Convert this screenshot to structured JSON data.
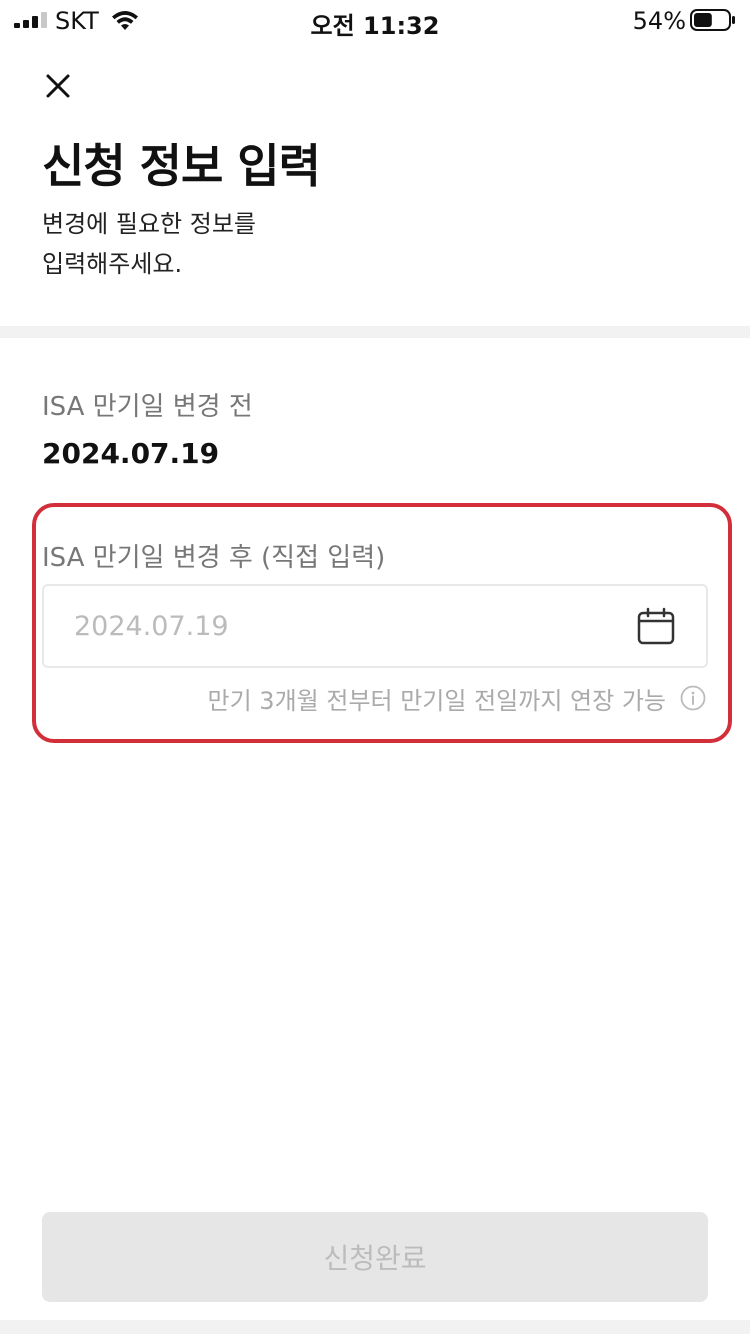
{
  "status_bar": {
    "carrier": "SKT",
    "time": "오전 11:32",
    "battery_percent": "54%",
    "battery_level": 0.54,
    "signal_bars_active": 3,
    "signal_bars_total": 4
  },
  "header": {
    "close_icon": "close-icon",
    "title": "신청 정보 입력",
    "description_line1": "변경에 필요한 정보를",
    "description_line2": "입력해주세요."
  },
  "before_change": {
    "label": "ISA 만기일 변경 전",
    "value": "2024.07.19"
  },
  "after_change": {
    "label": "ISA 만기일 변경 후 (직접 입력)",
    "placeholder": "2024.07.19",
    "value": "",
    "calendar_icon": "calendar-icon",
    "hint": "만기 3개월 전부터 만기일 전일까지 연장 가능",
    "info_icon": "info-icon"
  },
  "submit": {
    "label": "신청완료",
    "enabled": false
  },
  "colors": {
    "highlight_border": "#d32f3a",
    "disabled_button_bg": "#e6e6e6",
    "disabled_button_text": "#bcbcbc",
    "divider": "#f2f2f2",
    "placeholder": "#bbbbbb"
  }
}
